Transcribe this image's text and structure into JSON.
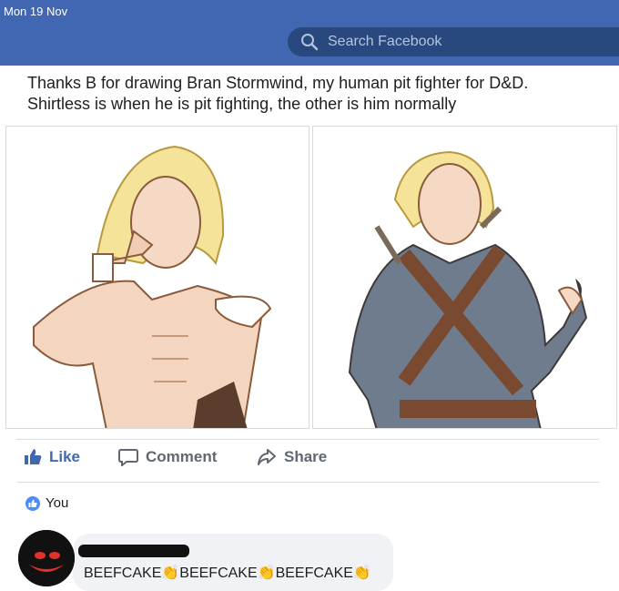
{
  "status_bar": {
    "date": "Mon 19 Nov"
  },
  "header": {
    "search_placeholder": "Search Facebook"
  },
  "post": {
    "text_line1": "Thanks B for drawing Bran Stormwind, my human pit fighter for D&D.",
    "text_line2": "Shirtless is when he is pit fighting,  the other is him normally"
  },
  "actions": {
    "like": "Like",
    "comment": "Comment",
    "share": "Share"
  },
  "reactions": {
    "names": "You"
  },
  "comment": {
    "text": "BEEFCAKE👏BEEFCAKE👏BEEFCAKE👏"
  },
  "colors": {
    "brand": "#4267b2",
    "like": "#4267b2",
    "bubble": "#f0f2f5"
  }
}
